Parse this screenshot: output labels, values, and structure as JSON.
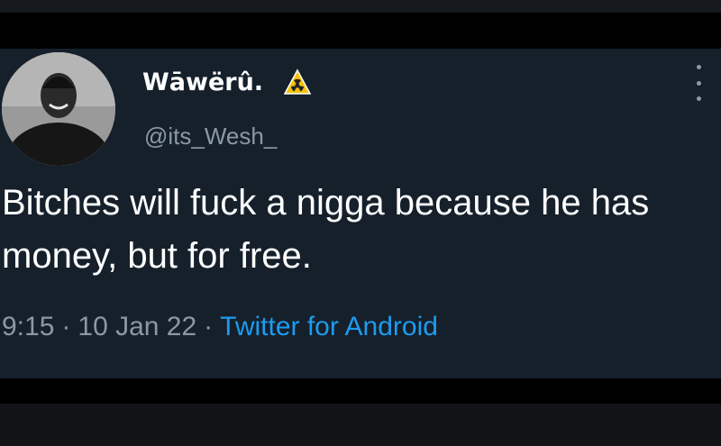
{
  "tweet": {
    "display_name": "Wāwërû.",
    "handle": "@its_Wesh_",
    "badge_icon": "warning-radioactive-icon",
    "text": "Bitches will fuck a nigga because he has money, but for free.",
    "time": "9:15",
    "date": "10 Jan 22",
    "source": "Twitter for Android",
    "more_icon": "vertical-dots-icon"
  },
  "colors": {
    "background": "#15202b",
    "primary_text": "#ffffff",
    "secondary_text": "#8b98a5",
    "link": "#1d9bf0",
    "badge": "#f4c20d"
  }
}
